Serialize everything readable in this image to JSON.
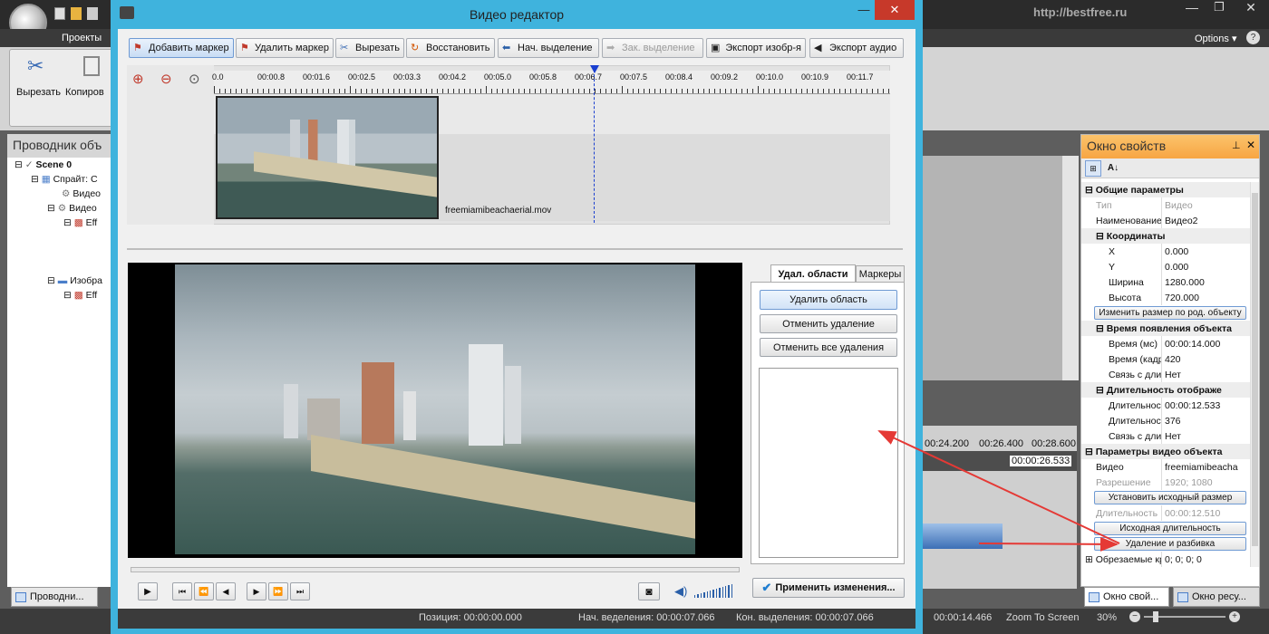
{
  "main_app": {
    "url_watermark": "http://bestfree.ru",
    "tab_projects": "Проекты",
    "options_label": "Options ▾",
    "ribbon_cut": "Вырезать",
    "ribbon_copy": "Копиров",
    "explorer_title": "Проводник объ",
    "tree": [
      "Scene 0",
      "Спрайт: С",
      "Видео",
      "Видео",
      "Eff",
      "Изобра",
      "Eff"
    ],
    "bottom_tab_explorer": "Проводни...",
    "timeline_labels": [
      "00:24.200",
      "00:26.400",
      "00:28.600"
    ],
    "timeline_marker": "00:00:26.533",
    "status_time": "00:00:14.466",
    "zoom_to_screen": "Zoom To Screen",
    "zoom_percent": "30%"
  },
  "dialog": {
    "title": "Видео редактор",
    "toolbar": {
      "add_marker": "Добавить маркер",
      "delete_marker": "Удалить маркер",
      "cut": "Вырезать",
      "restore": "Восстановить",
      "start_selection": "Нач. выделение",
      "end_selection": "Зак. выделение",
      "export_image": "Экспорт изобр-я",
      "export_audio": "Экспорт аудио"
    },
    "ruler_ticks": [
      "0.0",
      "00:00.8",
      "00:01.6",
      "00:02.5",
      "00:03.3",
      "00:04.2",
      "00:05.0",
      "00:05.8",
      "00:06.7",
      "00:07.5",
      "00:08.4",
      "00:09.2",
      "00:10.0",
      "00:10.9",
      "00:11.7"
    ],
    "clip_filename": "freemiamibeachaerial.mov",
    "panel_tabs": {
      "delete_areas": "Удал. области",
      "markers": "Маркеры"
    },
    "panel_buttons": {
      "delete_area": "Удалить область",
      "undo_delete": "Отменить удаление",
      "undo_all": "Отменить все удаления"
    },
    "apply_button": "Применить изменения...",
    "status": {
      "position": "Позиция: 00:00:00.000",
      "start_sel": "Нач. веделения: 00:00:07.066",
      "end_sel": "Кон. выделения: 00:00:07.066"
    }
  },
  "properties": {
    "title": "Окно свойств",
    "rows": [
      {
        "k": "Общие параметры",
        "v": "",
        "type": "section"
      },
      {
        "k": "Тип",
        "v": "Видео",
        "type": "gray"
      },
      {
        "k": "Наименование",
        "v": "Видео2",
        "type": "row"
      },
      {
        "k": "Координаты",
        "v": "",
        "type": "sub"
      },
      {
        "k": "X",
        "v": "0.000",
        "type": "row2"
      },
      {
        "k": "Y",
        "v": "0.000",
        "type": "row2"
      },
      {
        "k": "Ширина",
        "v": "1280.000",
        "type": "row2"
      },
      {
        "k": "Высота",
        "v": "720.000",
        "type": "row2"
      },
      {
        "k": "Изменить размер по род. объекту",
        "v": "",
        "type": "button"
      },
      {
        "k": "Время появления объекта",
        "v": "",
        "type": "sub"
      },
      {
        "k": "Время (мс)",
        "v": "00:00:14.000",
        "type": "row2"
      },
      {
        "k": "Время (кадр)",
        "v": "420",
        "type": "row2"
      },
      {
        "k": "Связь с длите",
        "v": "Нет",
        "type": "row2"
      },
      {
        "k": "Длительность отображе",
        "v": "",
        "type": "sub"
      },
      {
        "k": "Длительност",
        "v": "00:00:12.533",
        "type": "row2"
      },
      {
        "k": "Длительност",
        "v": "376",
        "type": "row2"
      },
      {
        "k": "Связь с длит",
        "v": "Нет",
        "type": "row2"
      },
      {
        "k": "Параметры видео объекта",
        "v": "",
        "type": "section"
      },
      {
        "k": "Видео",
        "v": "freemiamibeacha",
        "type": "row"
      },
      {
        "k": "Разрешение",
        "v": "1920; 1080",
        "type": "gray"
      },
      {
        "k": "Установить исходный размер",
        "v": "",
        "type": "button"
      },
      {
        "k": "Длительность",
        "v": "00:00:12.510",
        "type": "gray"
      },
      {
        "k": "Исходная длительность",
        "v": "",
        "type": "button"
      },
      {
        "k": "Удаление и разбивка",
        "v": "",
        "type": "button"
      },
      {
        "k": "Обрезаемые кра",
        "v": "0; 0; 0; 0",
        "type": "collapsed"
      }
    ],
    "bottom_tab_props": "Окно свой...",
    "bottom_tab_resources": "Окно ресу..."
  }
}
